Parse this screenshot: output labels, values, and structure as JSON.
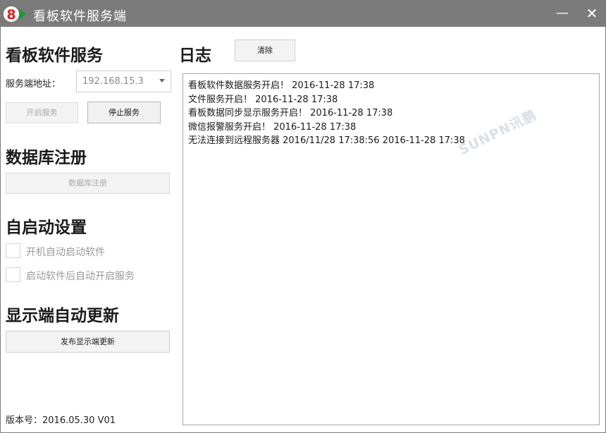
{
  "window": {
    "title": "看板软件服务端",
    "logo": {
      "text": "8",
      "accent": "#e02020",
      "play_color": "#1a9a3a"
    }
  },
  "controls": {
    "minimize_symbol": "—",
    "close_symbol": "✕"
  },
  "service": {
    "heading": "看板软件服务",
    "address_label": "服务端地址：",
    "address_value": "192.168.15.3",
    "start_label": "开启服务",
    "stop_label": "停止服务"
  },
  "database": {
    "heading": "数据库注册",
    "register_label": "数据库注册"
  },
  "autostart": {
    "heading": "自启动设置",
    "options": [
      {
        "label": "开机自动启动软件",
        "checked": false
      },
      {
        "label": "启动软件后自动开启服务",
        "checked": false
      }
    ]
  },
  "display_update": {
    "heading": "显示端自动更新",
    "publish_label": "发布显示端更新"
  },
  "log": {
    "heading": "日志",
    "clear_label": "清除",
    "lines": [
      "看板软件数据服务开启！ 2016-11-28 17:38",
      "文件服务开启！ 2016-11-28 17:38",
      "看板数据同步显示服务开启！ 2016-11-28 17:38",
      "微信报警服务开启！ 2016-11-28 17:38",
      "无法连接到远程服务器 2016/11/28 17:38:56 2016-11-28 17:38"
    ]
  },
  "watermark": "SUNPN讯鹏",
  "version": "版本号：2016.05.30 V01"
}
